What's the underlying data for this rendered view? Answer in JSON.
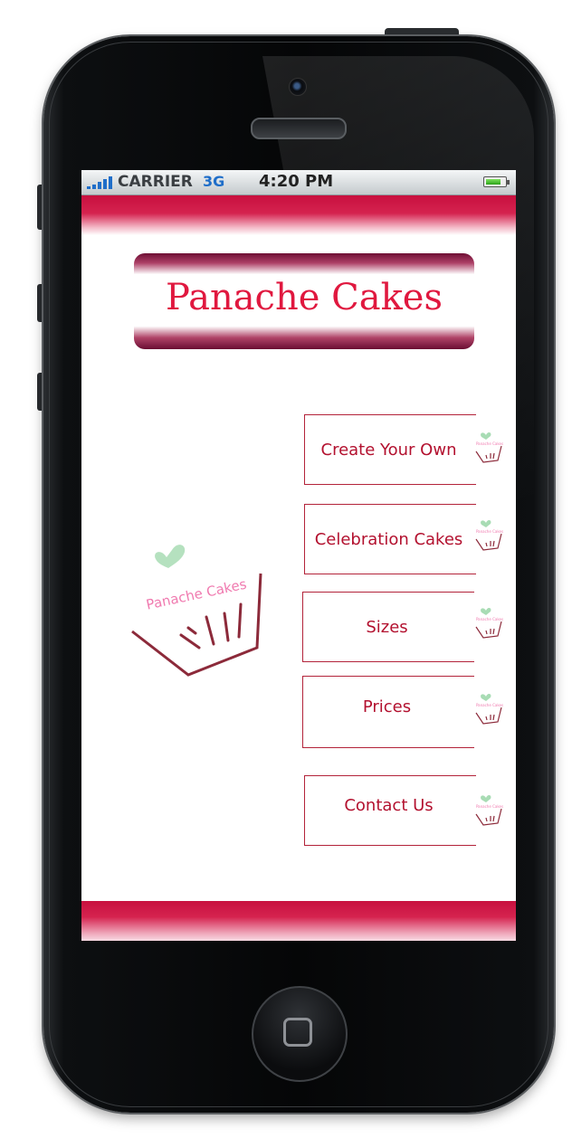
{
  "status_bar": {
    "carrier": "CARRIER",
    "network": "3G",
    "time": "4:20 PM"
  },
  "app": {
    "title": "Panache Cakes",
    "logo_text": "Panache Cakes",
    "menu": [
      {
        "label": "Create Your Own"
      },
      {
        "label": "Celebration Cakes"
      },
      {
        "label": "Sizes"
      },
      {
        "label": "Prices"
      },
      {
        "label": "Contact Us"
      }
    ]
  },
  "colors": {
    "brand_red": "#c8103f",
    "title_text": "#e0183f",
    "button_text": "#b3112f",
    "logo_pink": "#f07bb0",
    "logo_green": "#a8dcb4",
    "logo_basket": "#8c2a3a"
  }
}
